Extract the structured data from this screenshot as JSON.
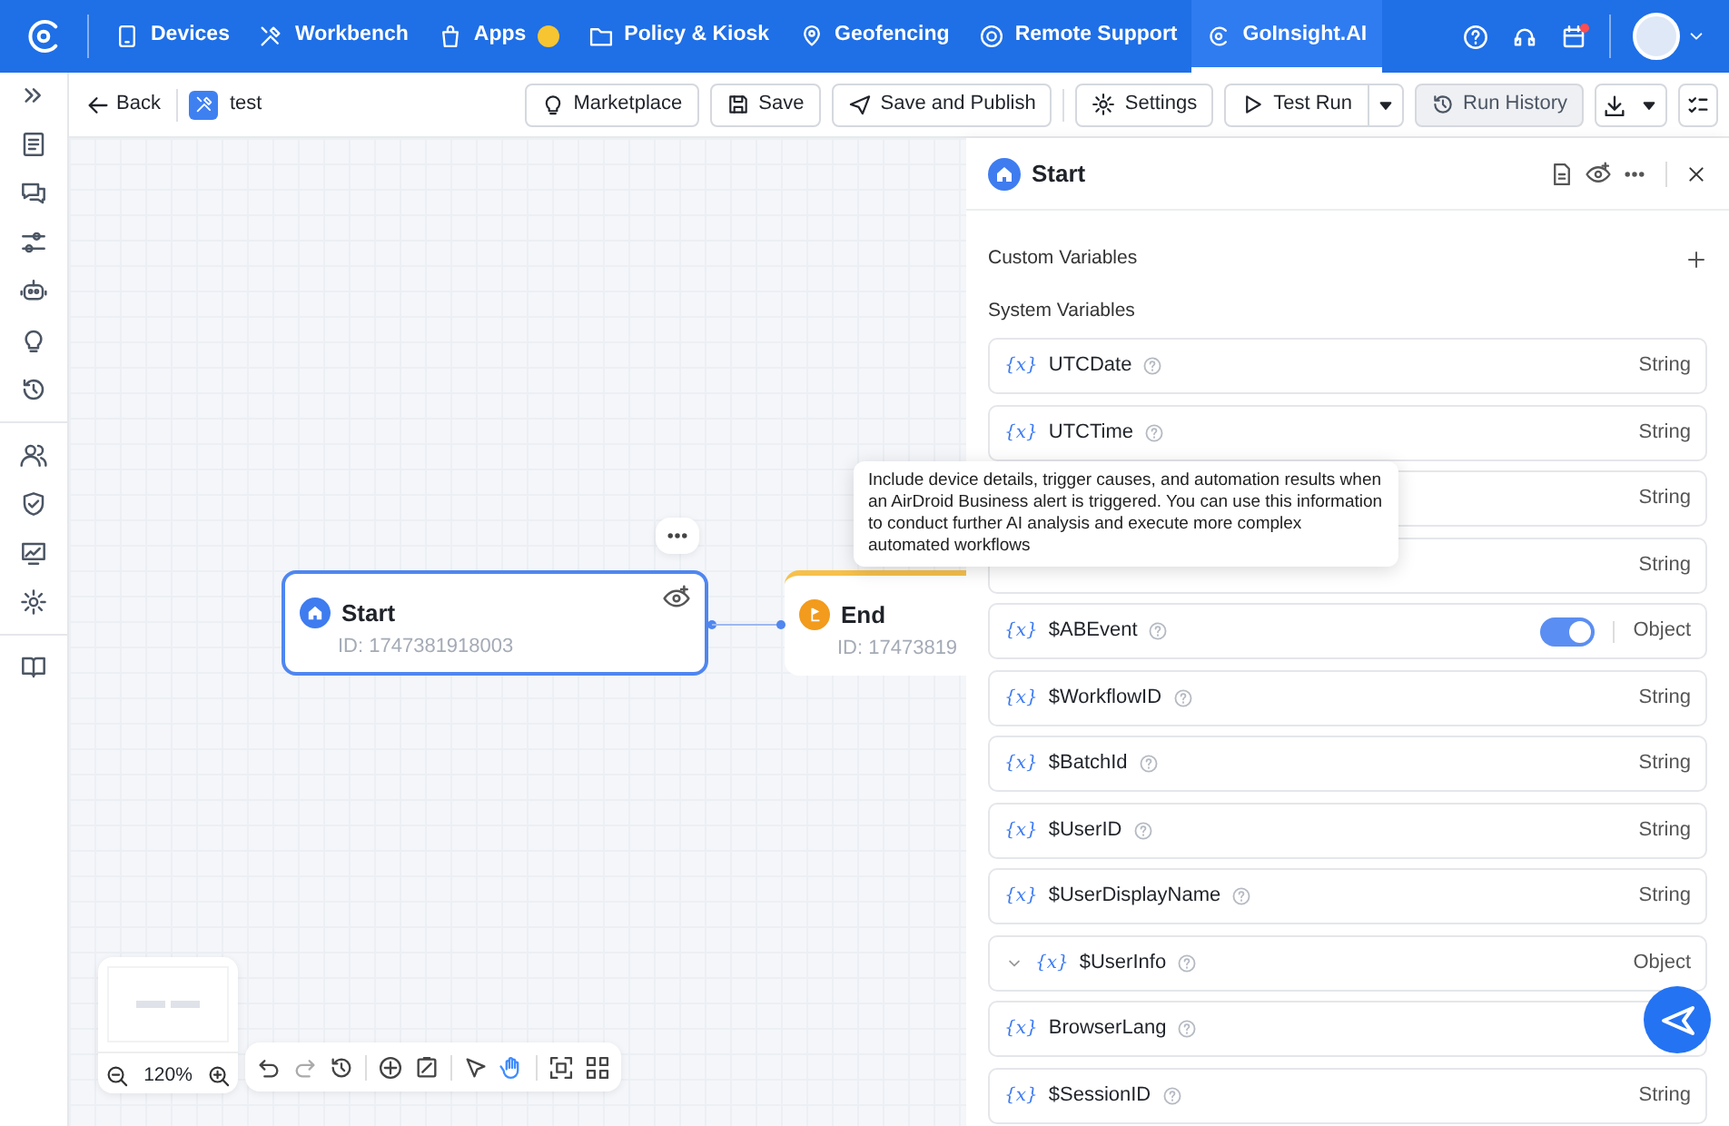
{
  "nav": {
    "items": [
      {
        "label": "Devices",
        "selected": false,
        "badge": false
      },
      {
        "label": "Workbench",
        "selected": false,
        "badge": false
      },
      {
        "label": "Apps",
        "selected": false,
        "badge": true
      },
      {
        "label": "Policy & Kiosk",
        "selected": false,
        "badge": false
      },
      {
        "label": "Geofencing",
        "selected": false,
        "badge": false
      },
      {
        "label": "Remote Support",
        "selected": false,
        "badge": false
      },
      {
        "label": "GoInsight.AI",
        "selected": true,
        "badge": false
      }
    ],
    "notification_dot": true
  },
  "toolbar": {
    "back": "Back",
    "workflow_name": "test",
    "buttons": [
      {
        "label": "Marketplace",
        "kind": "plain"
      },
      {
        "label": "Save",
        "kind": "plain"
      },
      {
        "label": "Save and Publish",
        "kind": "plain"
      },
      {
        "label": "Settings",
        "kind": "plain"
      },
      {
        "label": "Test Run",
        "kind": "split"
      },
      {
        "label": "Run History",
        "kind": "muted"
      }
    ]
  },
  "canvas": {
    "nodes": [
      {
        "kind": "start",
        "title": "Start",
        "id_text": "ID: 1747381918003",
        "selected": true
      },
      {
        "kind": "end",
        "title": "End",
        "id_text": "ID: 17473819",
        "selected": false
      }
    ],
    "zoom": "120%"
  },
  "tooltip": "Include device details, trigger causes, and automation results when an AirDroid Business alert is triggered. You can use this information to conduct further AI analysis and execute more complex automated workflows",
  "panel": {
    "title": "Start",
    "custom_variables": "Custom Variables",
    "system_variables": "System Variables",
    "variables": [
      {
        "kind": "plain",
        "tag": "{x}",
        "name": "UTCDate",
        "type": "String"
      },
      {
        "kind": "plain",
        "tag": "{x}",
        "name": "UTCTime",
        "type": "String"
      },
      {
        "kind": "covered",
        "type": "String"
      },
      {
        "kind": "covered",
        "type": "String"
      },
      {
        "kind": "toggle",
        "tag": "{x}",
        "name": "$ABEvent",
        "type": "Object",
        "on": true
      },
      {
        "kind": "plain",
        "tag": "{x}",
        "name": "$WorkflowID",
        "type": "String"
      },
      {
        "kind": "plain",
        "tag": "{x}",
        "name": "$BatchId",
        "type": "String"
      },
      {
        "kind": "plain",
        "tag": "{x}",
        "name": "$UserID",
        "type": "String"
      },
      {
        "kind": "plain",
        "tag": "{x}",
        "name": "$UserDisplayName",
        "type": "String"
      },
      {
        "kind": "expandable",
        "tag": "{x}",
        "name": "$UserInfo",
        "type": "Object",
        "expanded": false
      },
      {
        "kind": "plain",
        "tag": "{x}",
        "name": "BrowserLang"
      },
      {
        "kind": "plain",
        "tag": "{x}",
        "name": "$SessionID",
        "type": "String"
      }
    ]
  }
}
